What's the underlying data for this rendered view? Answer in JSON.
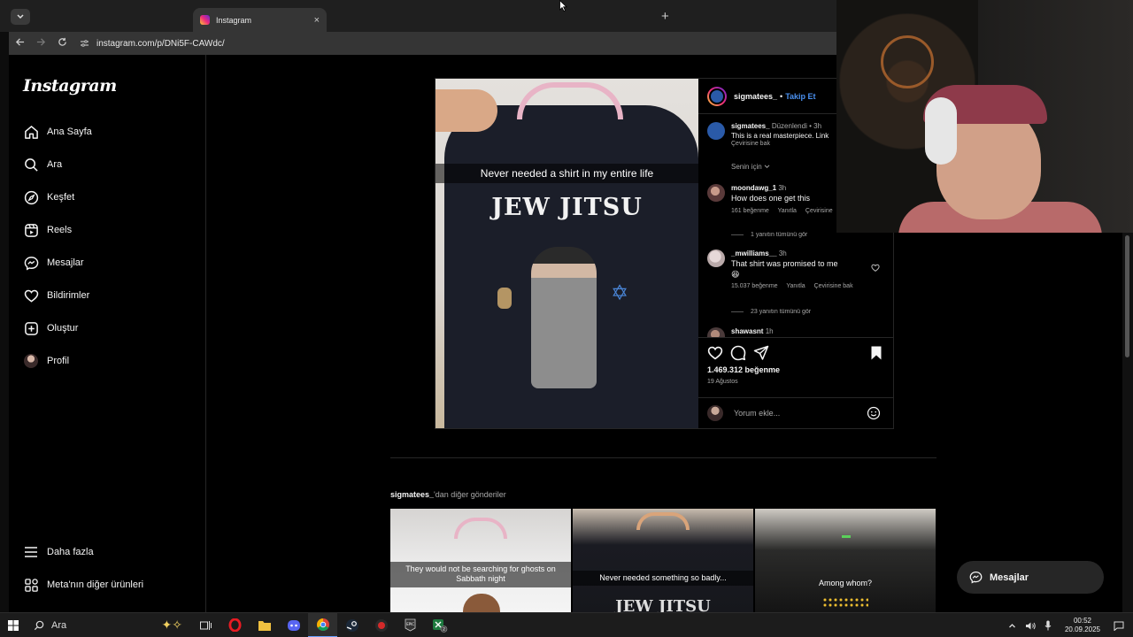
{
  "browser": {
    "tab_title": "Instagram",
    "tab_close": "×",
    "new_tab": "+",
    "url": "instagram.com/p/DNi5F-CAWdc/"
  },
  "sidebar": {
    "logo": "Instagram",
    "items": [
      {
        "label": "Ana Sayfa",
        "icon": "home-icon"
      },
      {
        "label": "Ara",
        "icon": "search-icon"
      },
      {
        "label": "Keşfet",
        "icon": "compass-icon"
      },
      {
        "label": "Reels",
        "icon": "reels-icon"
      },
      {
        "label": "Mesajlar",
        "icon": "messenger-icon"
      },
      {
        "label": "Bildirimler",
        "icon": "heart-icon"
      },
      {
        "label": "Oluştur",
        "icon": "plus-square-icon"
      },
      {
        "label": "Profil",
        "icon": "avatar"
      }
    ],
    "bottom_items": [
      {
        "label": "Daha fazla",
        "icon": "menu-icon"
      },
      {
        "label": "Meta'nın diğer ürünleri",
        "icon": "grid-icon"
      }
    ]
  },
  "post": {
    "image_caption": "Never needed a shirt in my entire life",
    "shirt_text": "JEW JITSU",
    "author": "sigmatees_",
    "dot": "•",
    "follow": "Takip Et",
    "caption": {
      "user": "sigmatees_",
      "edited": "Düzenlendi",
      "time": "3h",
      "text": "This is a real masterpiece. Link",
      "translate": "Çevirisine bak"
    },
    "for_you": "Senin için",
    "comments": [
      {
        "user": "moondawg_1",
        "time": "3h",
        "text": "How does one get this",
        "likes": "161 beğenme",
        "reply": "Yanıtla",
        "translate": "Çevirisine",
        "replies": "1 yanıtın tümünü gör"
      },
      {
        "user": "_mwilliams__",
        "time": "3h",
        "text": "That shirt was promised to me",
        "text2": "😆",
        "likes": "15.037 beğenme",
        "reply": "Yanıtla",
        "translate": "Çevirisine bak",
        "replies": "23 yanıtın tümünü gör"
      },
      {
        "user": "shawasnt",
        "time": "1h"
      }
    ],
    "likes": "1.469.312 beğenme",
    "date": "19 Ağustos",
    "comment_placeholder": "Yorum ekle..."
  },
  "more": {
    "user": "sigmatees_",
    "suffix": "'dan diğer gönderiler",
    "thumbs": [
      {
        "caption": "They would not be searching for ghosts on Sabbath night"
      },
      {
        "caption": "Never needed something so badly..."
      },
      {
        "caption": "Among whom?"
      }
    ]
  },
  "messages_button": "Mesajlar",
  "taskbar": {
    "search_label": "Ara",
    "time": "00:52",
    "date": "20.09.2025"
  },
  "colors": {
    "bg": "#000000",
    "accent_blue": "#4a90f0",
    "border": "#262626"
  }
}
